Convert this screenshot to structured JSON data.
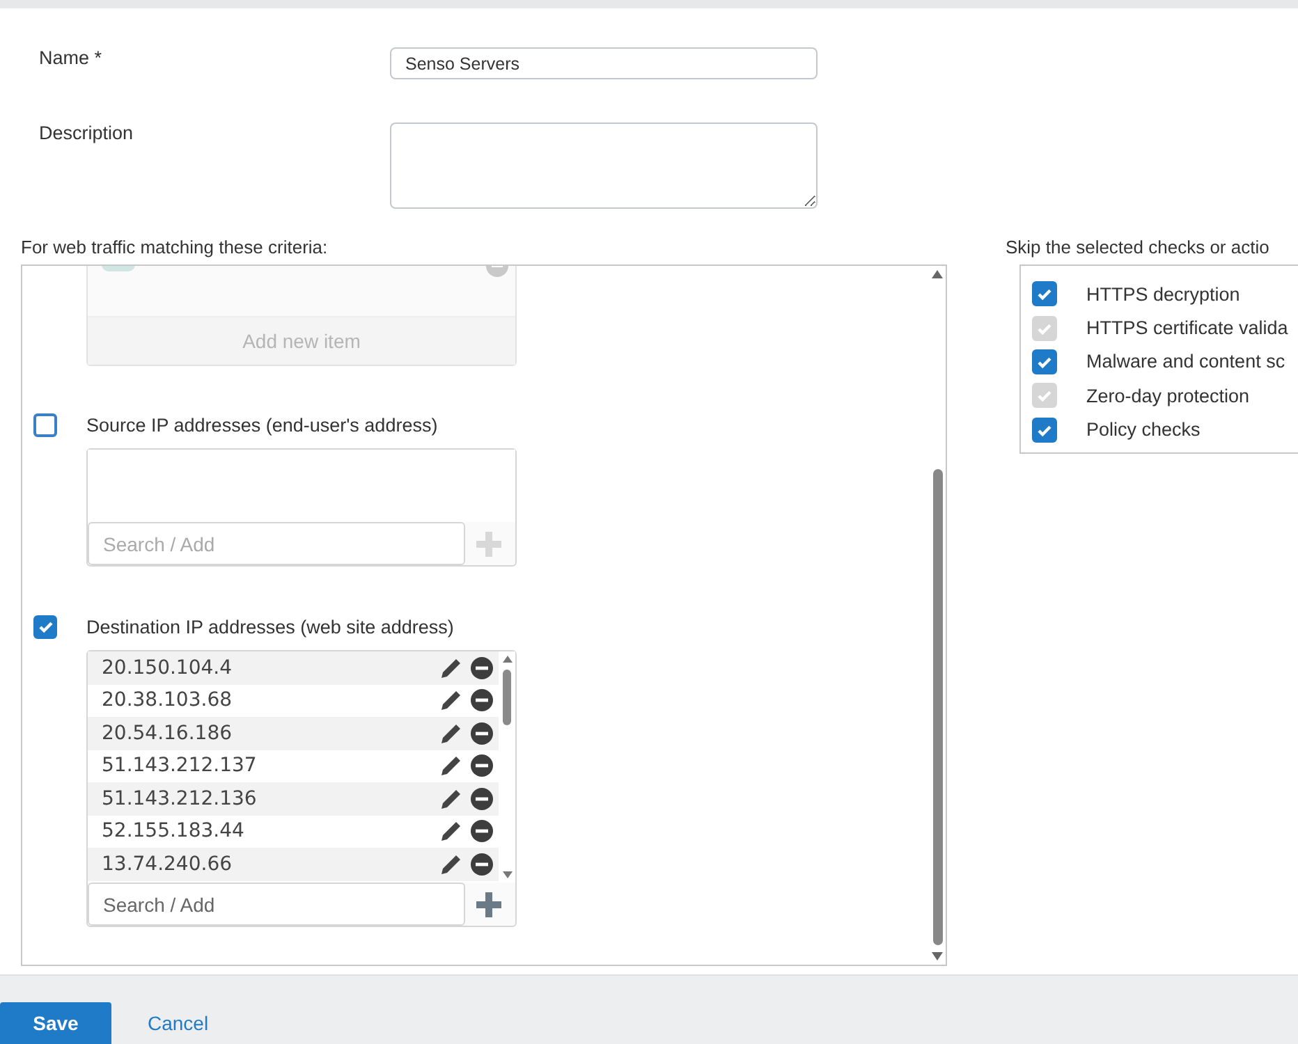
{
  "form": {
    "fields": [
      {
        "kind": "text",
        "label": "Name *",
        "value": "Senso Servers"
      },
      {
        "kind": "textarea",
        "label": "Description"
      }
    ]
  },
  "criteria": {
    "title": "For web traffic matching these criteria:",
    "top_list": {
      "footer": "Add new item"
    },
    "sections": [
      {
        "label": "Source IP addresses (end-user's address)",
        "checked": false,
        "search_placeholder": "Search / Add"
      },
      {
        "label": "Destination IP addresses (web site address)",
        "checked": true,
        "search_placeholder": "Search / Add",
        "items": [
          "20.150.104.4",
          "20.38.103.68",
          "20.54.16.186",
          "51.143.212.137",
          "51.143.212.136",
          "52.155.183.44",
          "13.74.240.66"
        ]
      }
    ]
  },
  "skip": {
    "title": "Skip the selected checks or actio",
    "options": [
      {
        "label": "HTTPS decryption",
        "checked": true,
        "disabled": false
      },
      {
        "label": "HTTPS certificate valida",
        "checked": true,
        "disabled": true
      },
      {
        "label": "Malware and content sc",
        "checked": true,
        "disabled": false
      },
      {
        "label": "Zero-day protection",
        "checked": true,
        "disabled": true
      },
      {
        "label": "Policy checks",
        "checked": true,
        "disabled": false
      }
    ]
  },
  "footer": {
    "buttons": [
      {
        "kind": "primary",
        "label": "Save"
      },
      {
        "kind": "link",
        "label": "Cancel"
      }
    ]
  }
}
